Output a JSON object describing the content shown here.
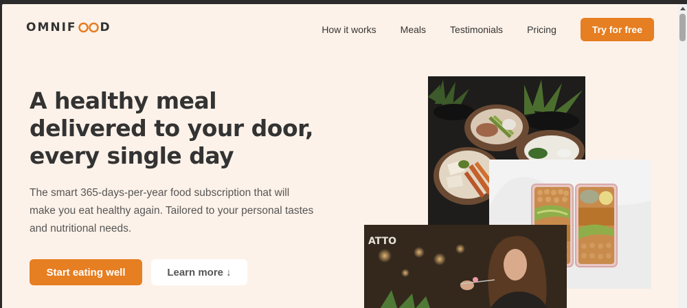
{
  "header": {
    "logo_left": "OMNIF",
    "logo_right": "D",
    "nav": [
      "How it works",
      "Meals",
      "Testimonials",
      "Pricing"
    ],
    "cta": "Try for free"
  },
  "hero": {
    "title_line1": "A healthy meal",
    "title_line2": "delivered to your door,",
    "title_line3": "every single day",
    "description": "The smart 365-days-per-year food subscription that will make you eat healthy again. Tailored to your personal tastes and nutritional needs.",
    "primary_button": "Start eating well",
    "secondary_button": "Learn more ↓"
  },
  "images": {
    "sign_text": "ATTO"
  },
  "colors": {
    "accent": "#e67e22",
    "background": "#fdf2e9",
    "text": "#333333"
  }
}
